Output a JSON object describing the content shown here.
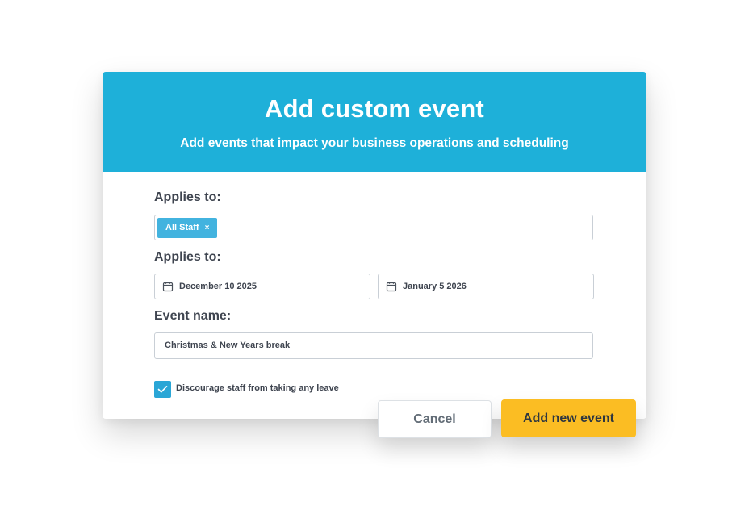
{
  "dialog": {
    "title": "Add custom event",
    "subtitle": "Add events that impact your business operations and scheduling"
  },
  "applies_to": {
    "label": "Applies to:",
    "tags": [
      {
        "label": "All Staff",
        "remove_symbol": "×"
      }
    ]
  },
  "dates": {
    "label": "Applies to:",
    "start_date": "December 10 2025",
    "end_date": "January 5 2026",
    "icon": "calendar-icon"
  },
  "event_name": {
    "label": "Event name:",
    "value": "Christmas & New Years break"
  },
  "discourage_leave": {
    "label": "Discourage staff from taking any leave",
    "checked": true
  },
  "actions": {
    "cancel_label": "Cancel",
    "submit_label": "Add new event"
  },
  "colors": {
    "header_bg": "#1eb0d9",
    "tag_bg": "#42b3df",
    "checkbox_bg": "#2aa6d6",
    "primary_button": "#fbbd23"
  }
}
